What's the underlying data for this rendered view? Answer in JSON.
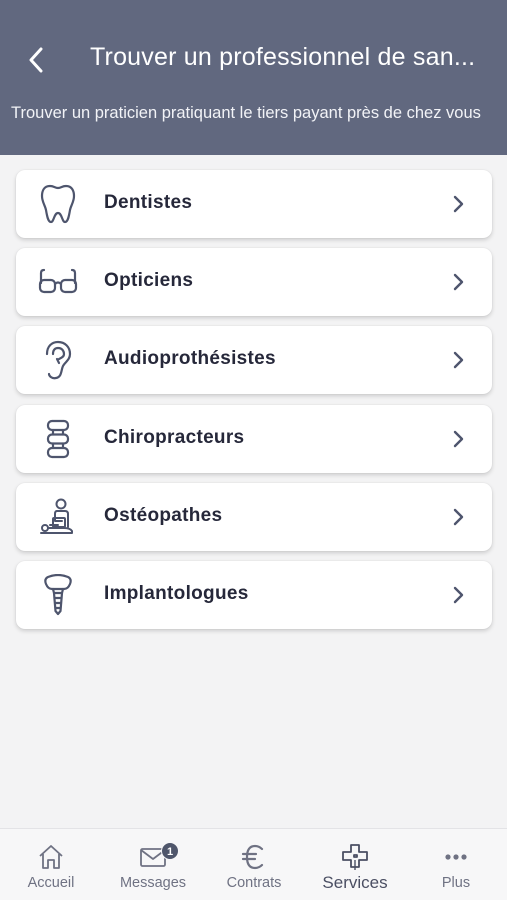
{
  "header": {
    "title": "Trouver un professionnel de san...",
    "subtitle": "Trouver un praticien pratiquant le tiers payant près de chez vous",
    "background": "#61687f"
  },
  "categories": [
    {
      "label": "Dentistes",
      "icon": "tooth-icon"
    },
    {
      "label": "Opticiens",
      "icon": "glasses-icon"
    },
    {
      "label": "Audioprothésistes",
      "icon": "ear-icon"
    },
    {
      "label": "Chiropracteurs",
      "icon": "spine-icon"
    },
    {
      "label": "Ostéopathes",
      "icon": "osteopath-icon"
    },
    {
      "label": "Implantologues",
      "icon": "implant-icon"
    }
  ],
  "tabs": [
    {
      "label": "Accueil",
      "icon": "home-icon"
    },
    {
      "label": "Messages",
      "icon": "mail-icon",
      "badge": "1"
    },
    {
      "label": "Contrats",
      "icon": "euro-icon"
    },
    {
      "label": "Services",
      "icon": "medical-cross-icon",
      "active": true
    },
    {
      "label": "Plus",
      "icon": "more-icon"
    }
  ]
}
